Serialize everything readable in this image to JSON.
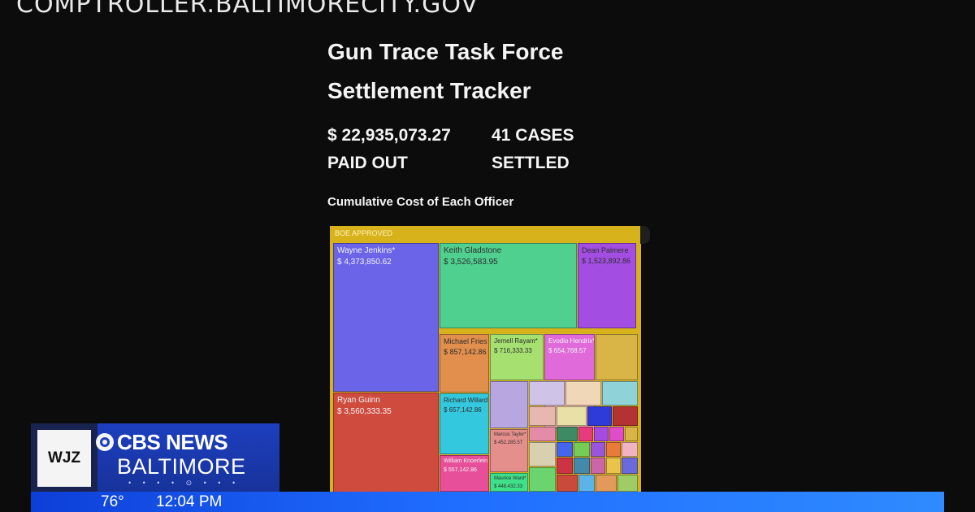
{
  "source": "COMPTROLLER.BALTIMORECITY.GOV",
  "title_line1": "Gun Trace Task Force",
  "title_line2": "Settlement Tracker",
  "stats": {
    "paid_amount": "$ 22,935,073.27",
    "paid_label": "PAID OUT",
    "cases_amount": "41 CASES",
    "cases_label": "SETTLED"
  },
  "chart_heading": "Cumulative Cost of Each Officer",
  "chart_data": {
    "type": "treemap",
    "title": "Cumulative Cost of Each Officer",
    "group": "BOE APPROVED",
    "items": [
      {
        "name": "Wayne Jenkins*",
        "value_label": "$ 4,373,850.62",
        "value": 4373850.62,
        "color": "#6b63e8"
      },
      {
        "name": "Keith Gladstone",
        "value_label": "$ 3,526,583.95",
        "value": 3526583.95,
        "color": "#4fd08f"
      },
      {
        "name": "Ryan Guinn",
        "value_label": "$ 3,560,333.35",
        "value": 3560333.35,
        "color": "#cf4b3d"
      },
      {
        "name": "Dean Palmere",
        "value_label": "$ 1,523,892.86",
        "value": 1523892.86,
        "color": "#a44de3"
      },
      {
        "name": "Michael Fries",
        "value_label": "$ 857,142.86",
        "value": 857142.86,
        "color": "#e28f4d"
      },
      {
        "name": "Jemell Rayam*",
        "value_label": "$ 716,333.33",
        "value": 716333.33,
        "color": "#a6e070"
      },
      {
        "name": "Evodio Hendrix*",
        "value_label": "$ 654,768.57",
        "value": 654768.57,
        "color": "#e06ad9"
      },
      {
        "name": "Richard Willard",
        "value_label": "$ 657,142.86",
        "value": 657142.86,
        "color": "#34c8de"
      },
      {
        "name": "William Knoerlein",
        "value_label": "$ 557,142.86",
        "value": 557142.86,
        "color": "#e74f9a"
      },
      {
        "name": "Marcus Taylor*",
        "value_label": "$ 452,285.57",
        "value": 452285.57,
        "color": "#e58f8c"
      },
      {
        "name": "Maurice Ward*",
        "value_label": "$ 448,432.33",
        "value": 448432.33,
        "color": "#3fe08a"
      }
    ]
  },
  "tv": {
    "station": "WJZ",
    "network": "CBS NEWS",
    "city": "BALTIMORE",
    "temperature": "76°",
    "time": "12:04 PM"
  }
}
